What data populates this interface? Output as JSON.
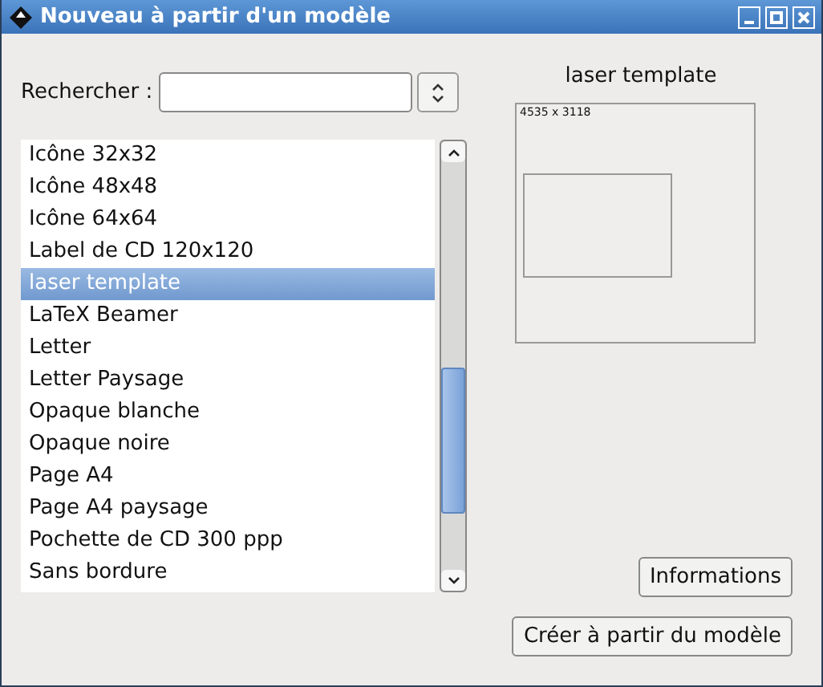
{
  "window": {
    "title": "Nouveau à partir d'un modèle"
  },
  "search": {
    "label": "Rechercher :"
  },
  "templates": [
    {
      "name": "Icône 32x32",
      "selected": false
    },
    {
      "name": "Icône 48x48",
      "selected": false
    },
    {
      "name": "Icône 64x64",
      "selected": false
    },
    {
      "name": "Label de CD 120x120",
      "selected": false
    },
    {
      "name": "laser template",
      "selected": true
    },
    {
      "name": "LaTeX Beamer",
      "selected": false
    },
    {
      "name": "Letter",
      "selected": false
    },
    {
      "name": "Letter Paysage",
      "selected": false
    },
    {
      "name": "Opaque blanche",
      "selected": false
    },
    {
      "name": "Opaque noire",
      "selected": false
    },
    {
      "name": "Page A4",
      "selected": false
    },
    {
      "name": "Page A4 paysage",
      "selected": false
    },
    {
      "name": "Pochette de CD 300 ppp",
      "selected": false
    },
    {
      "name": "Sans bordure",
      "selected": false
    }
  ],
  "preview": {
    "title": "laser template",
    "size": "4535 x 3118"
  },
  "buttons": [
    "Informations",
    "Créer à partir du modèle"
  ]
}
